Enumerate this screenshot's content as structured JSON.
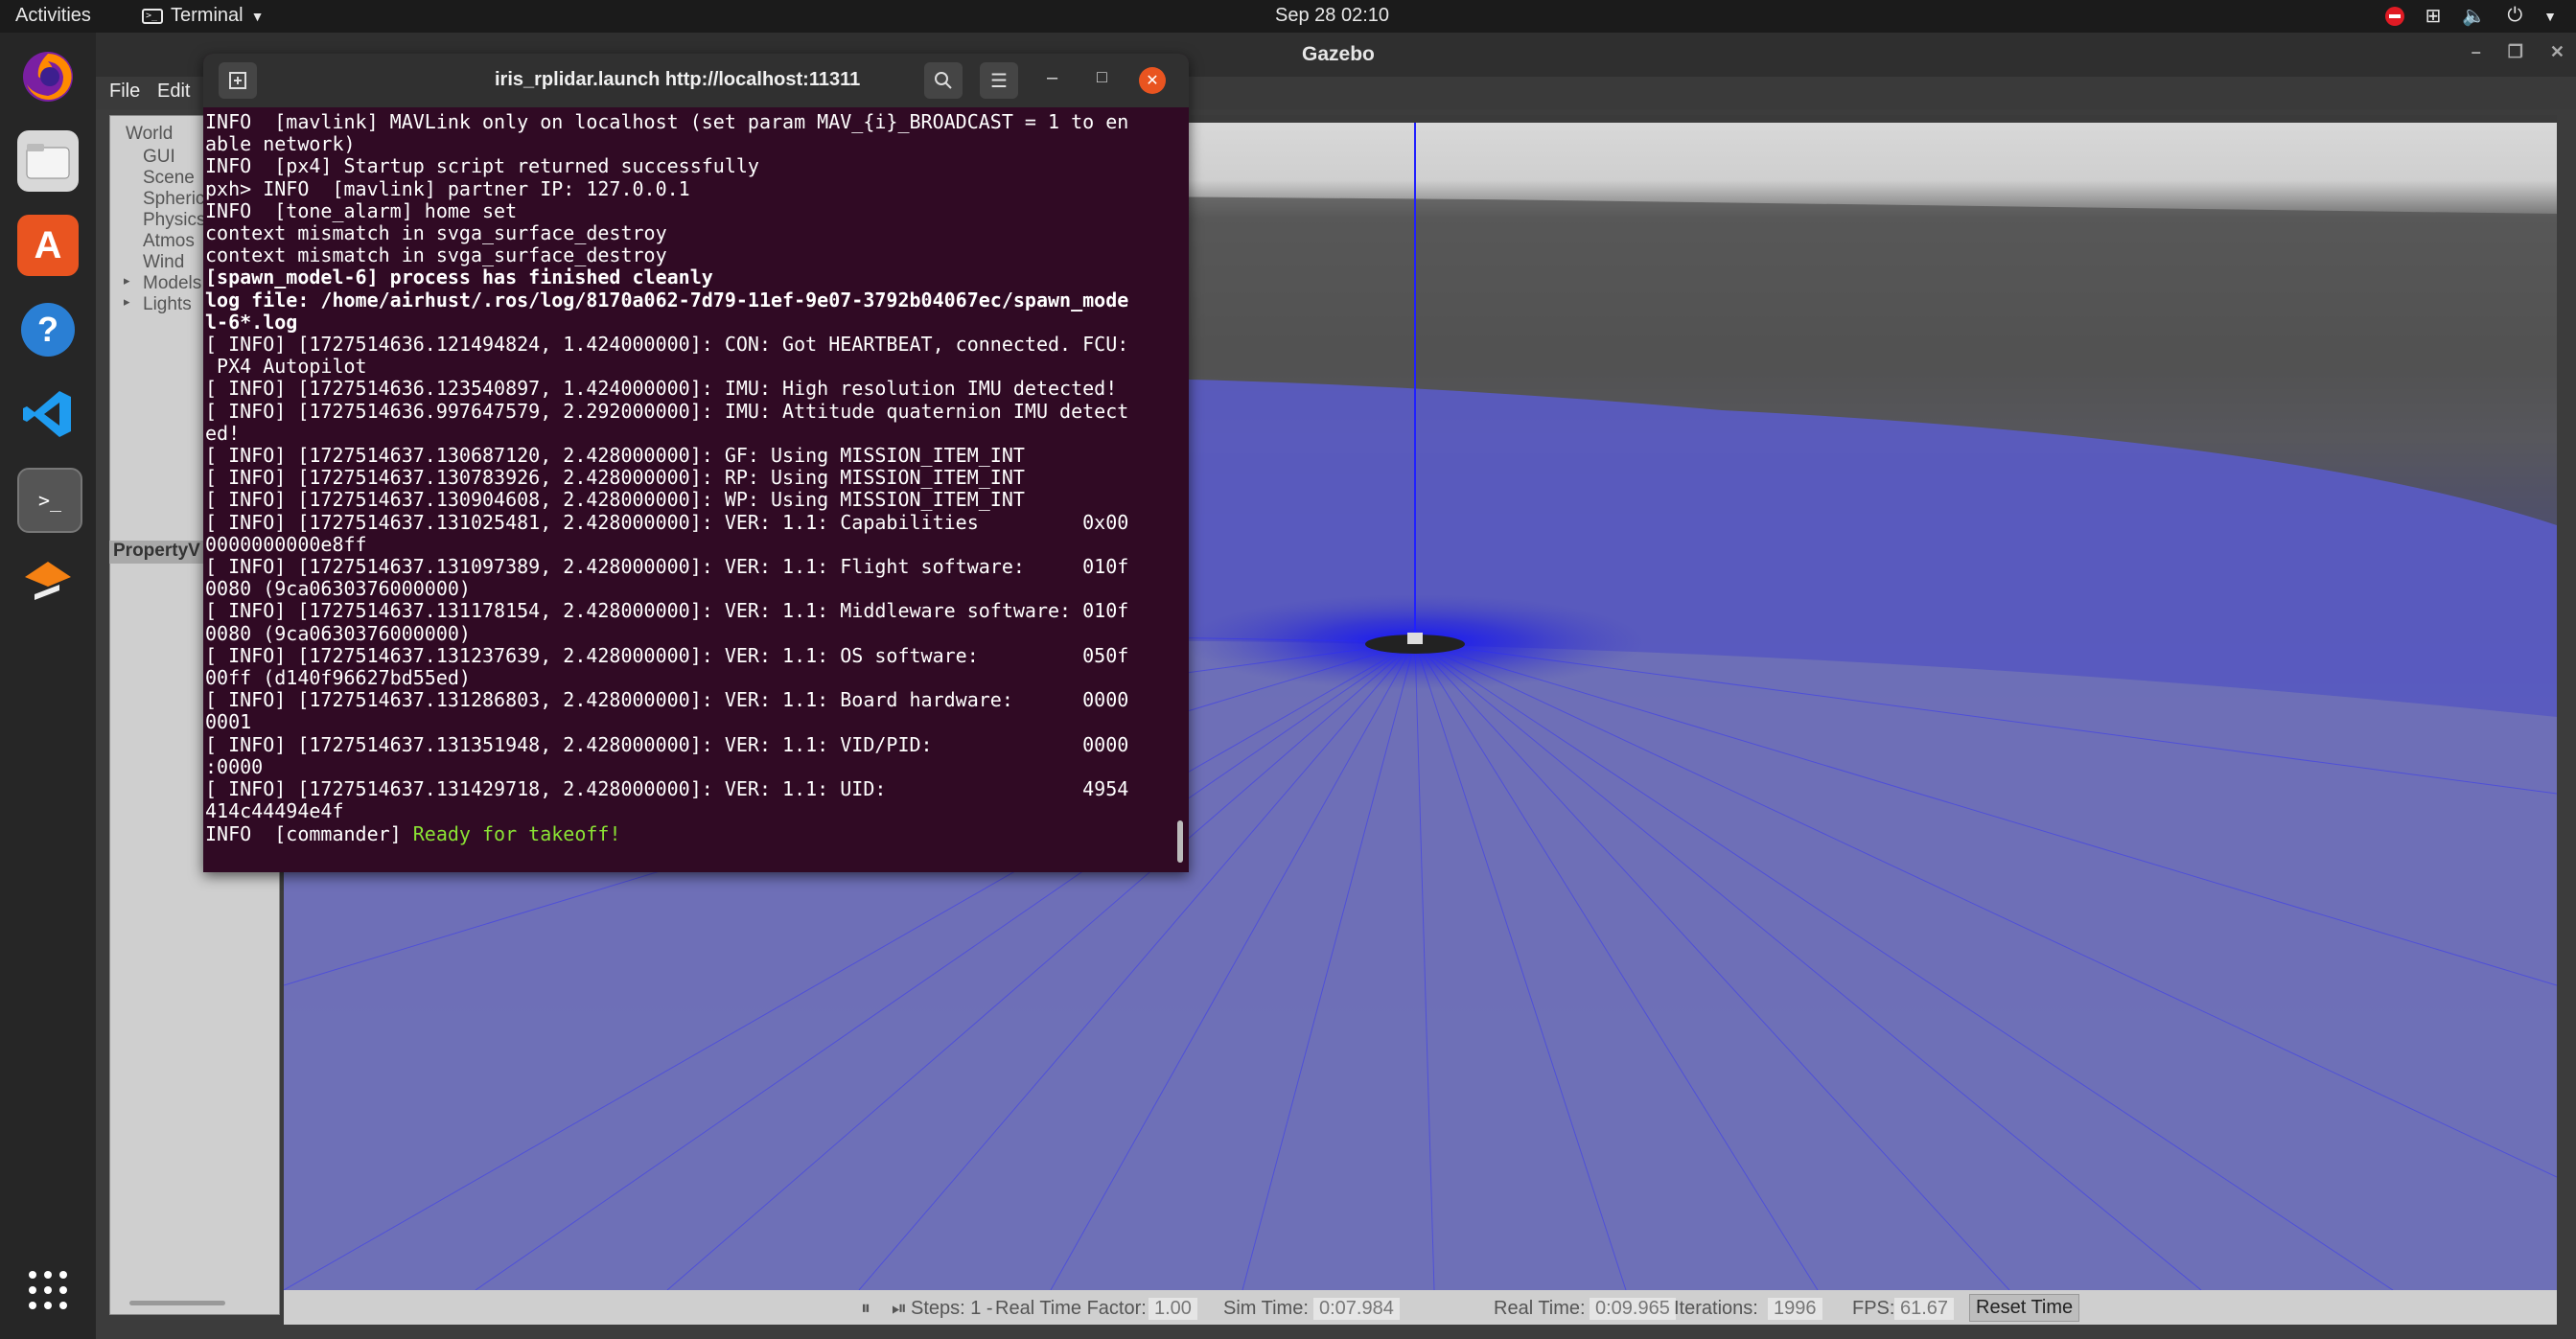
{
  "topbar": {
    "activities": "Activities",
    "app_name": "Terminal",
    "clock": "Sep 28  02:10"
  },
  "dock": {
    "items": [
      "firefox-icon",
      "files-icon",
      "app-store-icon",
      "help-icon",
      "vscode-icon",
      "terminal-icon",
      "gazebo-icon"
    ],
    "show_apps_icon": "grid-icon"
  },
  "gazebo": {
    "window_title": "Gazebo",
    "menu": {
      "file": "File",
      "edit": "Edit"
    },
    "tree": {
      "world": "World",
      "items": [
        "GUI",
        "Scene",
        "Spheric",
        "Physics",
        "Atmos",
        "Wind",
        "Models",
        "Lights"
      ]
    },
    "property_tab": "PropertyV",
    "bottombar": {
      "steps_label": "Steps: 1 -",
      "rtf_label": "Real Time Factor:",
      "rtf_value": "1.00",
      "sim_time_label": "Sim Time:",
      "sim_time_value": "0:07.984",
      "real_time_label": "Real Time:",
      "real_time_value": "0:09.965",
      "iterations_label": "Iterations:",
      "iterations_value": "1996",
      "fps_label": "FPS:",
      "fps_value": "61.67",
      "reset_time": "Reset Time"
    }
  },
  "terminal": {
    "title": "iris_rplidar.launch http://localhost:11311",
    "lines": [
      {
        "text": "INFO  [mavlink] MAVLink only on localhost (set param MAV_{i}_BROADCAST = 1 to en"
      },
      {
        "text": "able network)"
      },
      {
        "text": "INFO  [px4] Startup script returned successfully"
      },
      {
        "text": "pxh> INFO  [mavlink] partner IP: 127.0.0.1"
      },
      {
        "text": "INFO  [tone_alarm] home set"
      },
      {
        "text": "context mismatch in svga_surface_destroy"
      },
      {
        "text": "context mismatch in svga_surface_destroy"
      },
      {
        "text": "[spawn_model-6] process has finished cleanly",
        "bold": true
      },
      {
        "text": "log file: /home/airhust/.ros/log/8170a062-7d79-11ef-9e07-3792b04067ec/spawn_mode",
        "bold": true
      },
      {
        "text": "l-6*.log",
        "bold": true
      },
      {
        "text": "[ INFO] [1727514636.121494824, 1.424000000]: CON: Got HEARTBEAT, connected. FCU:"
      },
      {
        "text": " PX4 Autopilot"
      },
      {
        "text": "[ INFO] [1727514636.123540897, 1.424000000]: IMU: High resolution IMU detected!"
      },
      {
        "text": "[ INFO] [1727514636.997647579, 2.292000000]: IMU: Attitude quaternion IMU detect"
      },
      {
        "text": "ed!"
      },
      {
        "text": "[ INFO] [1727514637.130687120, 2.428000000]: GF: Using MISSION_ITEM_INT"
      },
      {
        "text": "[ INFO] [1727514637.130783926, 2.428000000]: RP: Using MISSION_ITEM_INT"
      },
      {
        "text": "[ INFO] [1727514637.130904608, 2.428000000]: WP: Using MISSION_ITEM_INT"
      },
      {
        "text": "[ INFO] [1727514637.131025481, 2.428000000]: VER: 1.1: Capabilities         0x00"
      },
      {
        "text": "0000000000e8ff"
      },
      {
        "text": "[ INFO] [1727514637.131097389, 2.428000000]: VER: 1.1: Flight software:     010f"
      },
      {
        "text": "0080 (9ca0630376000000)"
      },
      {
        "text": "[ INFO] [1727514637.131178154, 2.428000000]: VER: 1.1: Middleware software: 010f"
      },
      {
        "text": "0080 (9ca0630376000000)"
      },
      {
        "text": "[ INFO] [1727514637.131237639, 2.428000000]: VER: 1.1: OS software:         050f"
      },
      {
        "text": "00ff (d140f96627bd55ed)"
      },
      {
        "text": "[ INFO] [1727514637.131286803, 2.428000000]: VER: 1.1: Board hardware:      0000"
      },
      {
        "text": "0001"
      },
      {
        "text": "[ INFO] [1727514637.131351948, 2.428000000]: VER: 1.1: VID/PID:             0000"
      },
      {
        "text": ":0000"
      },
      {
        "text": "[ INFO] [1727514637.131429718, 2.428000000]: VER: 1.1: UID:                 4954"
      },
      {
        "text": "414c44494e4f"
      }
    ],
    "last_line": {
      "prefix": "INFO  [commander] ",
      "highlight": "Ready for takeoff!"
    }
  },
  "colors": {
    "terminal_bg": "#300a24",
    "ready_green": "#8ae234",
    "close_btn": "#e95420"
  }
}
